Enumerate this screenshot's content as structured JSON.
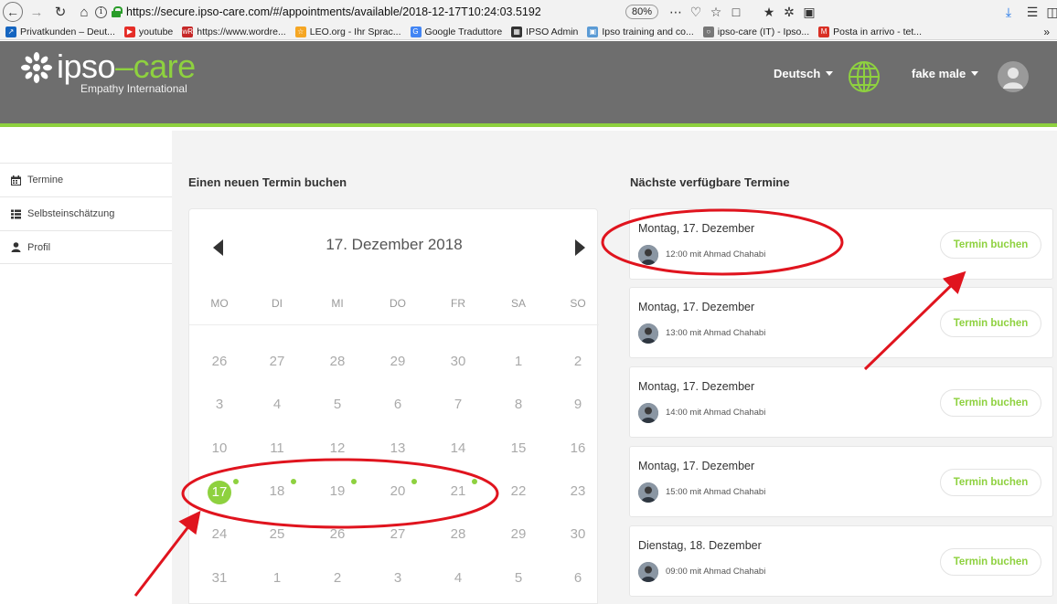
{
  "browser": {
    "url": "https://secure.ipso-care.com/#/appointments/available/2018-12-17T10:24:03.5192",
    "zoom": "80%",
    "bookmarks": [
      {
        "label": "Privatkunden – Deut...",
        "color": "#1565c0",
        "glyph": "↗"
      },
      {
        "label": "youtube",
        "color": "#e52d27",
        "glyph": "▶"
      },
      {
        "label": "https://www.wordre...",
        "color": "#c62828",
        "glyph": "wR"
      },
      {
        "label": "LEO.org - Ihr Sprac...",
        "color": "#f5a623",
        "glyph": "☆"
      },
      {
        "label": "Google Traduttore",
        "color": "#4285f4",
        "glyph": "G"
      },
      {
        "label": "IPSO Admin",
        "color": "#333333",
        "glyph": "▦"
      },
      {
        "label": "Ipso training and co...",
        "color": "#5b9bd5",
        "glyph": "▣"
      },
      {
        "label": "ipso-care (IT) - Ipso...",
        "color": "#777777",
        "glyph": "○"
      },
      {
        "label": "Posta in arrivo - tet...",
        "color": "#d93025",
        "glyph": "M"
      }
    ]
  },
  "header": {
    "logo_main": "ipso",
    "logo_dash": "–",
    "logo_care": "care",
    "logo_sub": "Empathy International",
    "language": "Deutsch",
    "user_name": "fake male",
    "accent": "#8ed13f"
  },
  "sidebar": {
    "items": [
      {
        "label": "Termine",
        "icon": "calendar-icon"
      },
      {
        "label": "Selbsteinschätzung",
        "icon": "list-icon"
      },
      {
        "label": "Profil",
        "icon": "user-icon"
      }
    ]
  },
  "booking": {
    "title": "Einen neuen Termin buchen",
    "calendar_title": "17. Dezember 2018",
    "weekdays": [
      "MO",
      "DI",
      "MI",
      "DO",
      "FR",
      "SA",
      "SO"
    ],
    "weeks": [
      [
        "26",
        "27",
        "28",
        "29",
        "30",
        "1",
        "2"
      ],
      [
        "3",
        "4",
        "5",
        "6",
        "7",
        "8",
        "9"
      ],
      [
        "10",
        "11",
        "12",
        "13",
        "14",
        "15",
        "16"
      ],
      [
        "17",
        "18",
        "19",
        "20",
        "21",
        "22",
        "23"
      ],
      [
        "24",
        "25",
        "26",
        "27",
        "28",
        "29",
        "30"
      ],
      [
        "31",
        "1",
        "2",
        "3",
        "4",
        "5",
        "6"
      ]
    ],
    "selected_day": "17",
    "days_with_slots": [
      "17",
      "18",
      "19",
      "20",
      "21"
    ]
  },
  "upcoming": {
    "title": "Nächste verfügbare Termine",
    "book_label": "Termin buchen",
    "appointments": [
      {
        "date": "Montag, 17. Dezember",
        "detail": "12:00 mit Ahmad Chahabi"
      },
      {
        "date": "Montag, 17. Dezember",
        "detail": "13:00 mit Ahmad Chahabi"
      },
      {
        "date": "Montag, 17. Dezember",
        "detail": "14:00 mit Ahmad Chahabi"
      },
      {
        "date": "Montag, 17. Dezember",
        "detail": "15:00 mit Ahmad Chahabi"
      },
      {
        "date": "Dienstag, 18. Dezember",
        "detail": "09:00 mit Ahmad Chahabi"
      }
    ]
  },
  "annotation_color": "#e0141e"
}
